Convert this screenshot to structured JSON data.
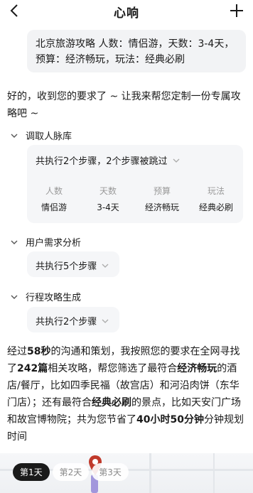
{
  "nav": {
    "title": "心响"
  },
  "user_message": "北京旅游攻略  人数：情侣游，天数：3-4天，预算：经济畅玩，玩法：经典必刷",
  "intro": "好的，收到您的要求了 ~ 让我来帮您定制一份专属攻略吧 ~",
  "steps": [
    {
      "title": "调取人脉库",
      "summary": "共执行2个步骤，2个步骤被跳过"
    },
    {
      "title": "用户需求分析",
      "summary": "共执行5个步骤"
    },
    {
      "title": "行程攻略生成",
      "summary": "共执行2个步骤"
    }
  ],
  "params": [
    {
      "name": "人数",
      "value": "情侣游"
    },
    {
      "name": "天数",
      "value": "3-4天"
    },
    {
      "name": "预算",
      "value": "经济畅玩"
    },
    {
      "name": "玩法",
      "value": "经典必刷"
    }
  ],
  "summary": {
    "p1": "经过",
    "h1": "58秒",
    "p2": "的沟通和策划，我按照您的要求在全网寻找了",
    "h2": "242篇",
    "p3": "相关攻略，帮您筛选了最符合",
    "h3": "经济畅玩",
    "p4": "的酒店/餐厅，比如四季民福（故宫店）和河沿肉饼（东华门店）；还有最符合",
    "h4": "经典必刷",
    "p5": "的景点，比如天安门广场和故宫博物院；共为您节省了",
    "h5": "40小时50分钟",
    "p6": "分钟规划时间"
  },
  "day_tabs": [
    "第1天",
    "第2天",
    "第3天"
  ],
  "colors": {
    "active_tab": "#1a1a1a",
    "card_bg": "#f5f6f8",
    "bubble_bg": "#f2f3f5",
    "route": "#8f7fd6",
    "pin": "#c0392b"
  }
}
